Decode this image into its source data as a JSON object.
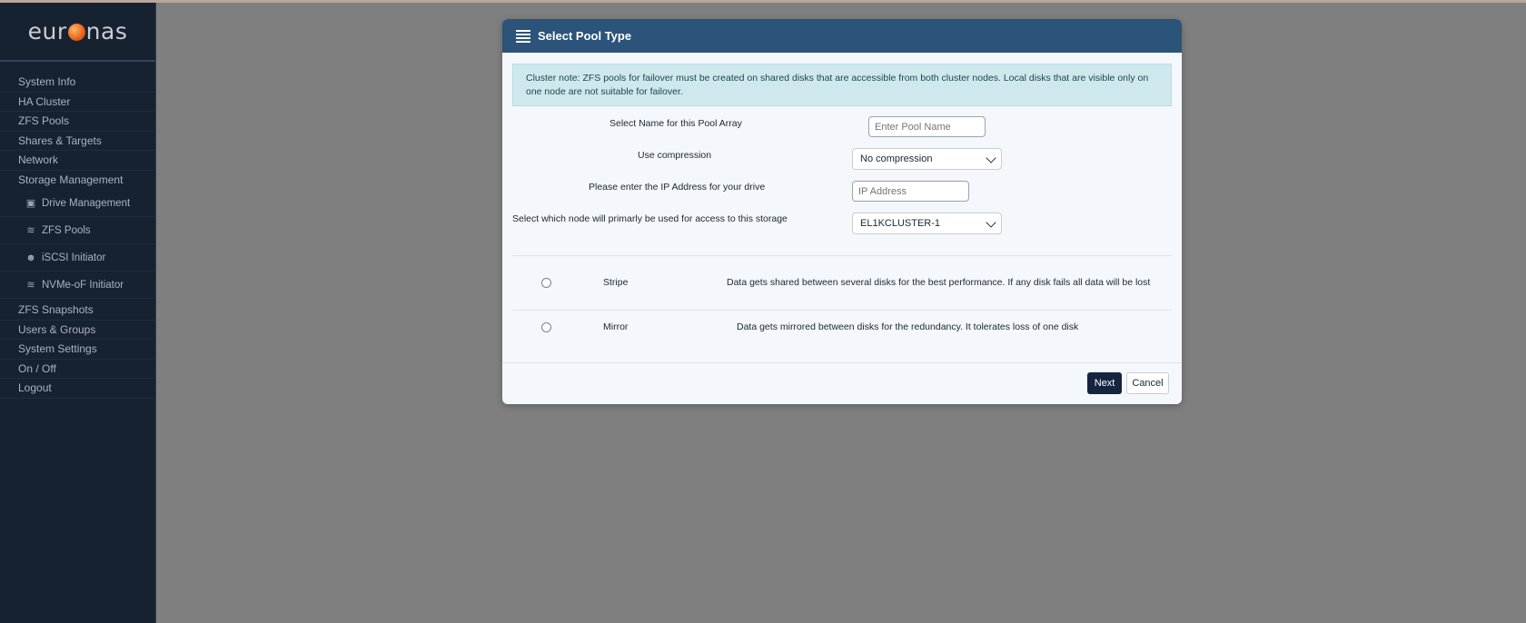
{
  "app": {
    "logo_left": "eur",
    "logo_right": "nas"
  },
  "sidebar": {
    "items": [
      {
        "label": "System Info"
      },
      {
        "label": "HA Cluster"
      },
      {
        "label": "ZFS Pools"
      },
      {
        "label": "Shares & Targets"
      },
      {
        "label": "Network"
      },
      {
        "label": "Storage Management"
      }
    ],
    "sub_items": [
      {
        "label": "Drive Management",
        "icon": "drive-icon"
      },
      {
        "label": "ZFS Pools",
        "icon": "layers-icon"
      },
      {
        "label": "iSCSI Initiator",
        "icon": "user-icon"
      },
      {
        "label": "NVMe-oF Initiator",
        "icon": "layers-icon"
      }
    ],
    "items_after": [
      {
        "label": "ZFS Snapshots"
      },
      {
        "label": "Users & Groups"
      },
      {
        "label": "System Settings"
      },
      {
        "label": "On / Off"
      },
      {
        "label": "Logout"
      }
    ]
  },
  "dialog": {
    "title": "Select Pool Type",
    "note": "Cluster note: ZFS pools for failover must be created on shared disks that are accessible from both cluster nodes. Local disks that are visible only on one node are not suitable for failover.",
    "fields": {
      "pool_name_label": "Select Name for this Pool Array",
      "pool_name_placeholder": "Enter Pool Name",
      "compression_label": "Use compression",
      "compression_value": "No compression",
      "ip_label": "Please enter the IP Address for your drive",
      "ip_placeholder": "IP Address",
      "node_label": "Select which node will primarly be used for access to this storage",
      "node_value": "EL1KCLUSTER-1"
    },
    "options": [
      {
        "name": "Stripe",
        "description": "Data gets shared between several disks for the best performance. If any disk fails all data will be lost"
      },
      {
        "name": "Mirror",
        "description": "Data gets mirrored between disks for the redundancy. It tolerates loss of one disk"
      }
    ],
    "buttons": {
      "next": "Next",
      "cancel": "Cancel"
    }
  },
  "colors": {
    "sidebar_bg": "#172231",
    "overlay_bg": "#7f7f7f",
    "dialog_header": "#2c5379",
    "note_bg": "#cfe8ee",
    "primary_button": "#15243f"
  }
}
